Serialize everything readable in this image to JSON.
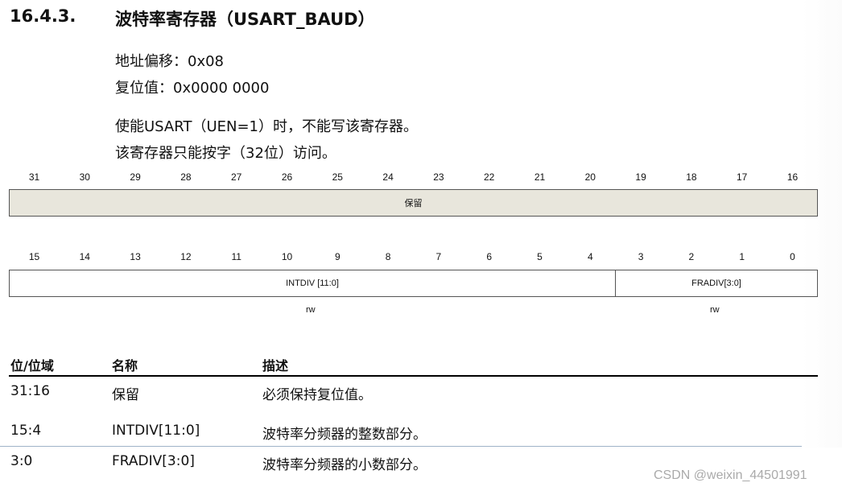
{
  "section": {
    "number": "16.4.3.",
    "title": "波特率寄存器（USART_BAUD）"
  },
  "info": {
    "offset": "地址偏移：0x08",
    "reset": "复位值：0x0000 0000",
    "note1": "使能USART（UEN=1）时，不能写该寄存器。",
    "note2": "该寄存器只能按字（32位）访问。"
  },
  "upper_bits": [
    "31",
    "30",
    "29",
    "28",
    "27",
    "26",
    "25",
    "24",
    "23",
    "22",
    "21",
    "20",
    "19",
    "18",
    "17",
    "16"
  ],
  "lower_bits": [
    "15",
    "14",
    "13",
    "12",
    "11",
    "10",
    "9",
    "8",
    "7",
    "6",
    "5",
    "4",
    "3",
    "2",
    "1",
    "0"
  ],
  "fields": {
    "reserved": "保留",
    "intdiv": "INTDIV [11:0]",
    "fradiv": "FRADIV[3:0]",
    "intdiv_access": "rw",
    "fradiv_access": "rw"
  },
  "table": {
    "headers": [
      "位/位域",
      "名称",
      "描述"
    ],
    "rows": [
      {
        "bits": "31:16",
        "name": "保留",
        "desc": "必须保持复位值。"
      },
      {
        "bits": "15:4",
        "name": "INTDIV[11:0]",
        "desc": "波特率分频器的整数部分。"
      },
      {
        "bits": "3:0",
        "name": "FRADIV[3:0]",
        "desc": "波特率分频器的小数部分。"
      }
    ]
  },
  "watermark": "CSDN @weixin_44501991",
  "colors": {
    "reserved_fill": "#e8e6dc",
    "divider": "#9fb3c8"
  }
}
